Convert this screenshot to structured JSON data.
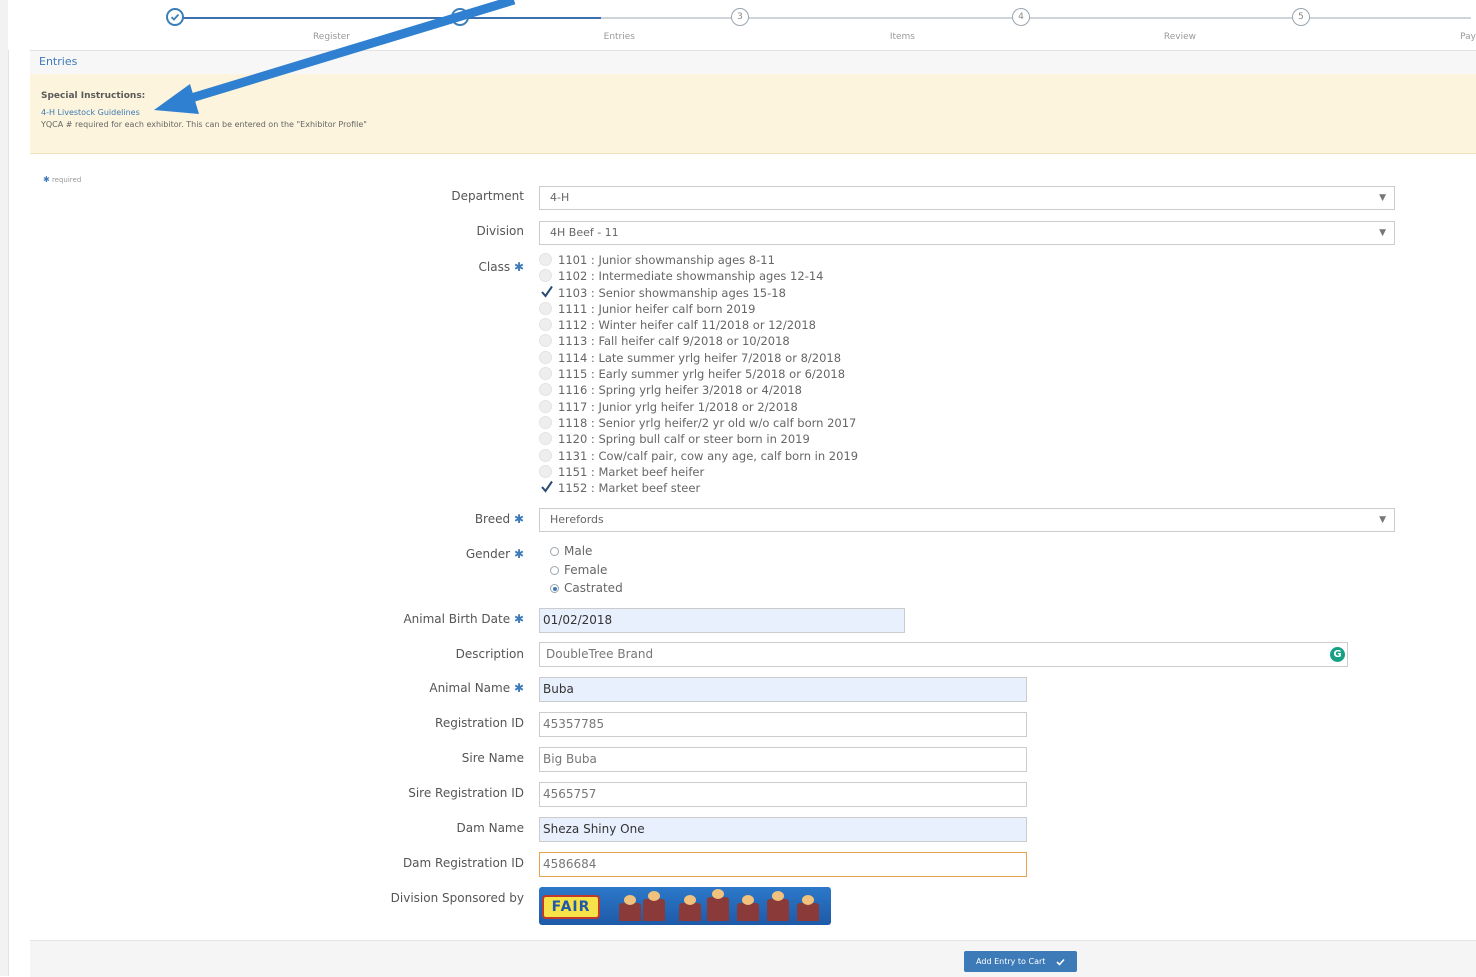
{
  "stepper": {
    "steps": [
      {
        "label": "Register",
        "number": "",
        "state": "done"
      },
      {
        "label": "Entries",
        "number": "",
        "state": "done"
      },
      {
        "label": "Items",
        "number": "3",
        "state": "todo"
      },
      {
        "label": "Review",
        "number": "4",
        "state": "todo"
      },
      {
        "label": "Pay",
        "number": "5",
        "state": "todo"
      }
    ]
  },
  "panel": {
    "title": "Entries"
  },
  "instructions": {
    "title": "Special Instructions:",
    "link": "4-H Livestock Guidelines",
    "note": "YQCA # required for each exhibitor. This can be entered on the \"Exhibitor Profile\""
  },
  "required_note": "required",
  "form": {
    "department": {
      "label": "Department",
      "value": "4-H"
    },
    "division": {
      "label": "Division",
      "value": "4H Beef - 11"
    },
    "class": {
      "label": "Class",
      "options": [
        {
          "text": "1101 : Junior showmanship ages 8-11",
          "checked": false
        },
        {
          "text": "1102 : Intermediate showmanship ages 12-14",
          "checked": false
        },
        {
          "text": "1103 : Senior showmanship ages 15-18",
          "checked": true
        },
        {
          "text": "1111 : Junior heifer calf born 2019",
          "checked": false
        },
        {
          "text": "1112 : Winter heifer calf 11/2018 or 12/2018",
          "checked": false
        },
        {
          "text": "1113 : Fall heifer calf 9/2018 or 10/2018",
          "checked": false
        },
        {
          "text": "1114 : Late summer yrlg heifer 7/2018 or 8/2018",
          "checked": false
        },
        {
          "text": "1115 : Early summer yrlg heifer 5/2018 or 6/2018",
          "checked": false
        },
        {
          "text": "1116 : Spring yrlg heifer 3/2018 or 4/2018",
          "checked": false
        },
        {
          "text": "1117 : Junior yrlg heifer 1/2018 or 2/2018",
          "checked": false
        },
        {
          "text": "1118 : Senior yrlg heifer/2 yr old w/o calf born 2017",
          "checked": false
        },
        {
          "text": "1120 : Spring bull calf or steer born in 2019",
          "checked": false
        },
        {
          "text": "1131 : Cow/calf pair, cow any age, calf born in 2019",
          "checked": false
        },
        {
          "text": "1151 : Market beef heifer",
          "checked": false
        },
        {
          "text": "1152 : Market beef steer",
          "checked": true
        }
      ]
    },
    "breed": {
      "label": "Breed",
      "value": "Herefords"
    },
    "gender": {
      "label": "Gender",
      "options": [
        {
          "text": "Male",
          "selected": false
        },
        {
          "text": "Female",
          "selected": false
        },
        {
          "text": "Castrated",
          "selected": true
        }
      ]
    },
    "birth_date": {
      "label": "Animal Birth Date",
      "value": "01/02/2018"
    },
    "description": {
      "label": "Description",
      "value": "DoubleTree Brand"
    },
    "animal_name": {
      "label": "Animal Name",
      "value": "Buba"
    },
    "registration_id": {
      "label": "Registration ID",
      "value": "45357785"
    },
    "sire_name": {
      "label": "Sire Name",
      "value": "Big Buba"
    },
    "sire_registration_id": {
      "label": "Sire Registration ID",
      "value": "4565757"
    },
    "dam_name": {
      "label": "Dam Name",
      "value": "Sheza Shiny One"
    },
    "dam_registration_id": {
      "label": "Dam Registration ID",
      "value": "4586684"
    },
    "sponsor": {
      "label": "Division Sponsored by",
      "logo_text": "FAIR"
    }
  },
  "footer": {
    "add_to_cart": "Add Entry to Cart"
  },
  "colors": {
    "accent": "#3d7ab8",
    "instructions_bg": "#fcf4dc",
    "filled_input": "#e8f0fe",
    "annotation_arrow": "#2f80d0"
  }
}
